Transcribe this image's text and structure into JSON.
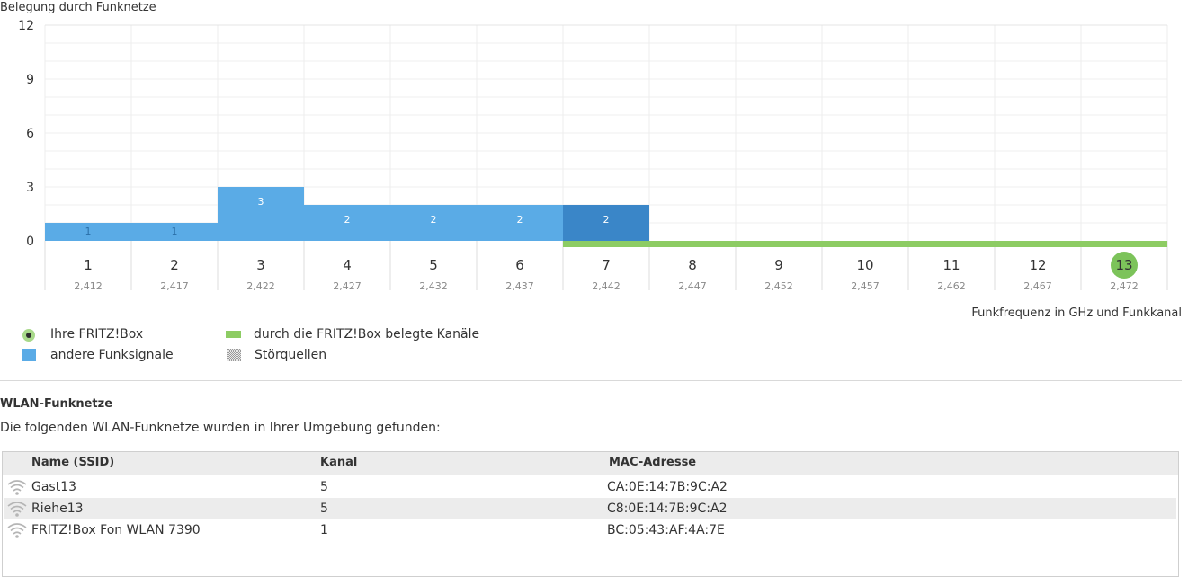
{
  "chart": {
    "title": "Belegung durch Funknetze",
    "x_caption": "Funkfrequenz in GHz und Funkkanal"
  },
  "chart_data": {
    "type": "bar",
    "title": "Belegung durch Funknetze",
    "xlabel": "Funkfrequenz in GHz und Funkkanal",
    "ylabel": "",
    "ylim": [
      0,
      12
    ],
    "yticks": [
      "0",
      "3",
      "6",
      "9",
      "12"
    ],
    "categories": [
      "1",
      "2",
      "3",
      "4",
      "5",
      "6",
      "7",
      "8",
      "9",
      "10",
      "11",
      "12",
      "13"
    ],
    "frequencies": [
      "2,412",
      "2,417",
      "2,422",
      "2,427",
      "2,432",
      "2,437",
      "2,442",
      "2,447",
      "2,452",
      "2,457",
      "2,462",
      "2,467",
      "2,472"
    ],
    "series": [
      {
        "name": "andere Funksignale",
        "values": [
          1,
          1,
          3,
          2,
          2,
          2,
          2,
          0,
          0,
          0,
          0,
          0,
          0
        ],
        "labels": [
          "1",
          "1",
          "3",
          "2",
          "2",
          "2",
          "2",
          "",
          "",
          "",
          "",
          "",
          ""
        ]
      }
    ],
    "highlighted_channel_index": 6,
    "fritzbox_channels": [
      "7",
      "8",
      "9",
      "10",
      "11",
      "12",
      "13"
    ],
    "fritzbox_channel": "13",
    "colors": {
      "other": "#5aabe6",
      "highlight": "#3a86c8",
      "fritzbox": "#8dcc63"
    },
    "grid": true
  },
  "legend": {
    "fritzbox": "Ihre FRITZ!Box",
    "other_signals": "andere Funksignale",
    "used_channels": "durch die FRITZ!Box belegte Kanäle",
    "interference": "Störquellen"
  },
  "wlan": {
    "title": "WLAN-Funknetze",
    "intro": "Die folgenden WLAN-Funknetze wurden in Ihrer Umgebung gefunden:",
    "columns": {
      "name": "Name (SSID)",
      "channel": "Kanal",
      "mac": "MAC-Adresse"
    },
    "rows": [
      {
        "name": "Gast13",
        "channel": "5",
        "mac": "CA:0E:14:7B:9C:A2",
        "icon": "wifi-icon"
      },
      {
        "name": "Riehe13",
        "channel": "5",
        "mac": "C8:0E:14:7B:9C:A2",
        "icon": "wifi-icon"
      },
      {
        "name": "FRITZ!Box Fon WLAN 7390",
        "channel": "1",
        "mac": "BC:05:43:AF:4A:7E",
        "icon": "wifi-icon"
      }
    ]
  }
}
